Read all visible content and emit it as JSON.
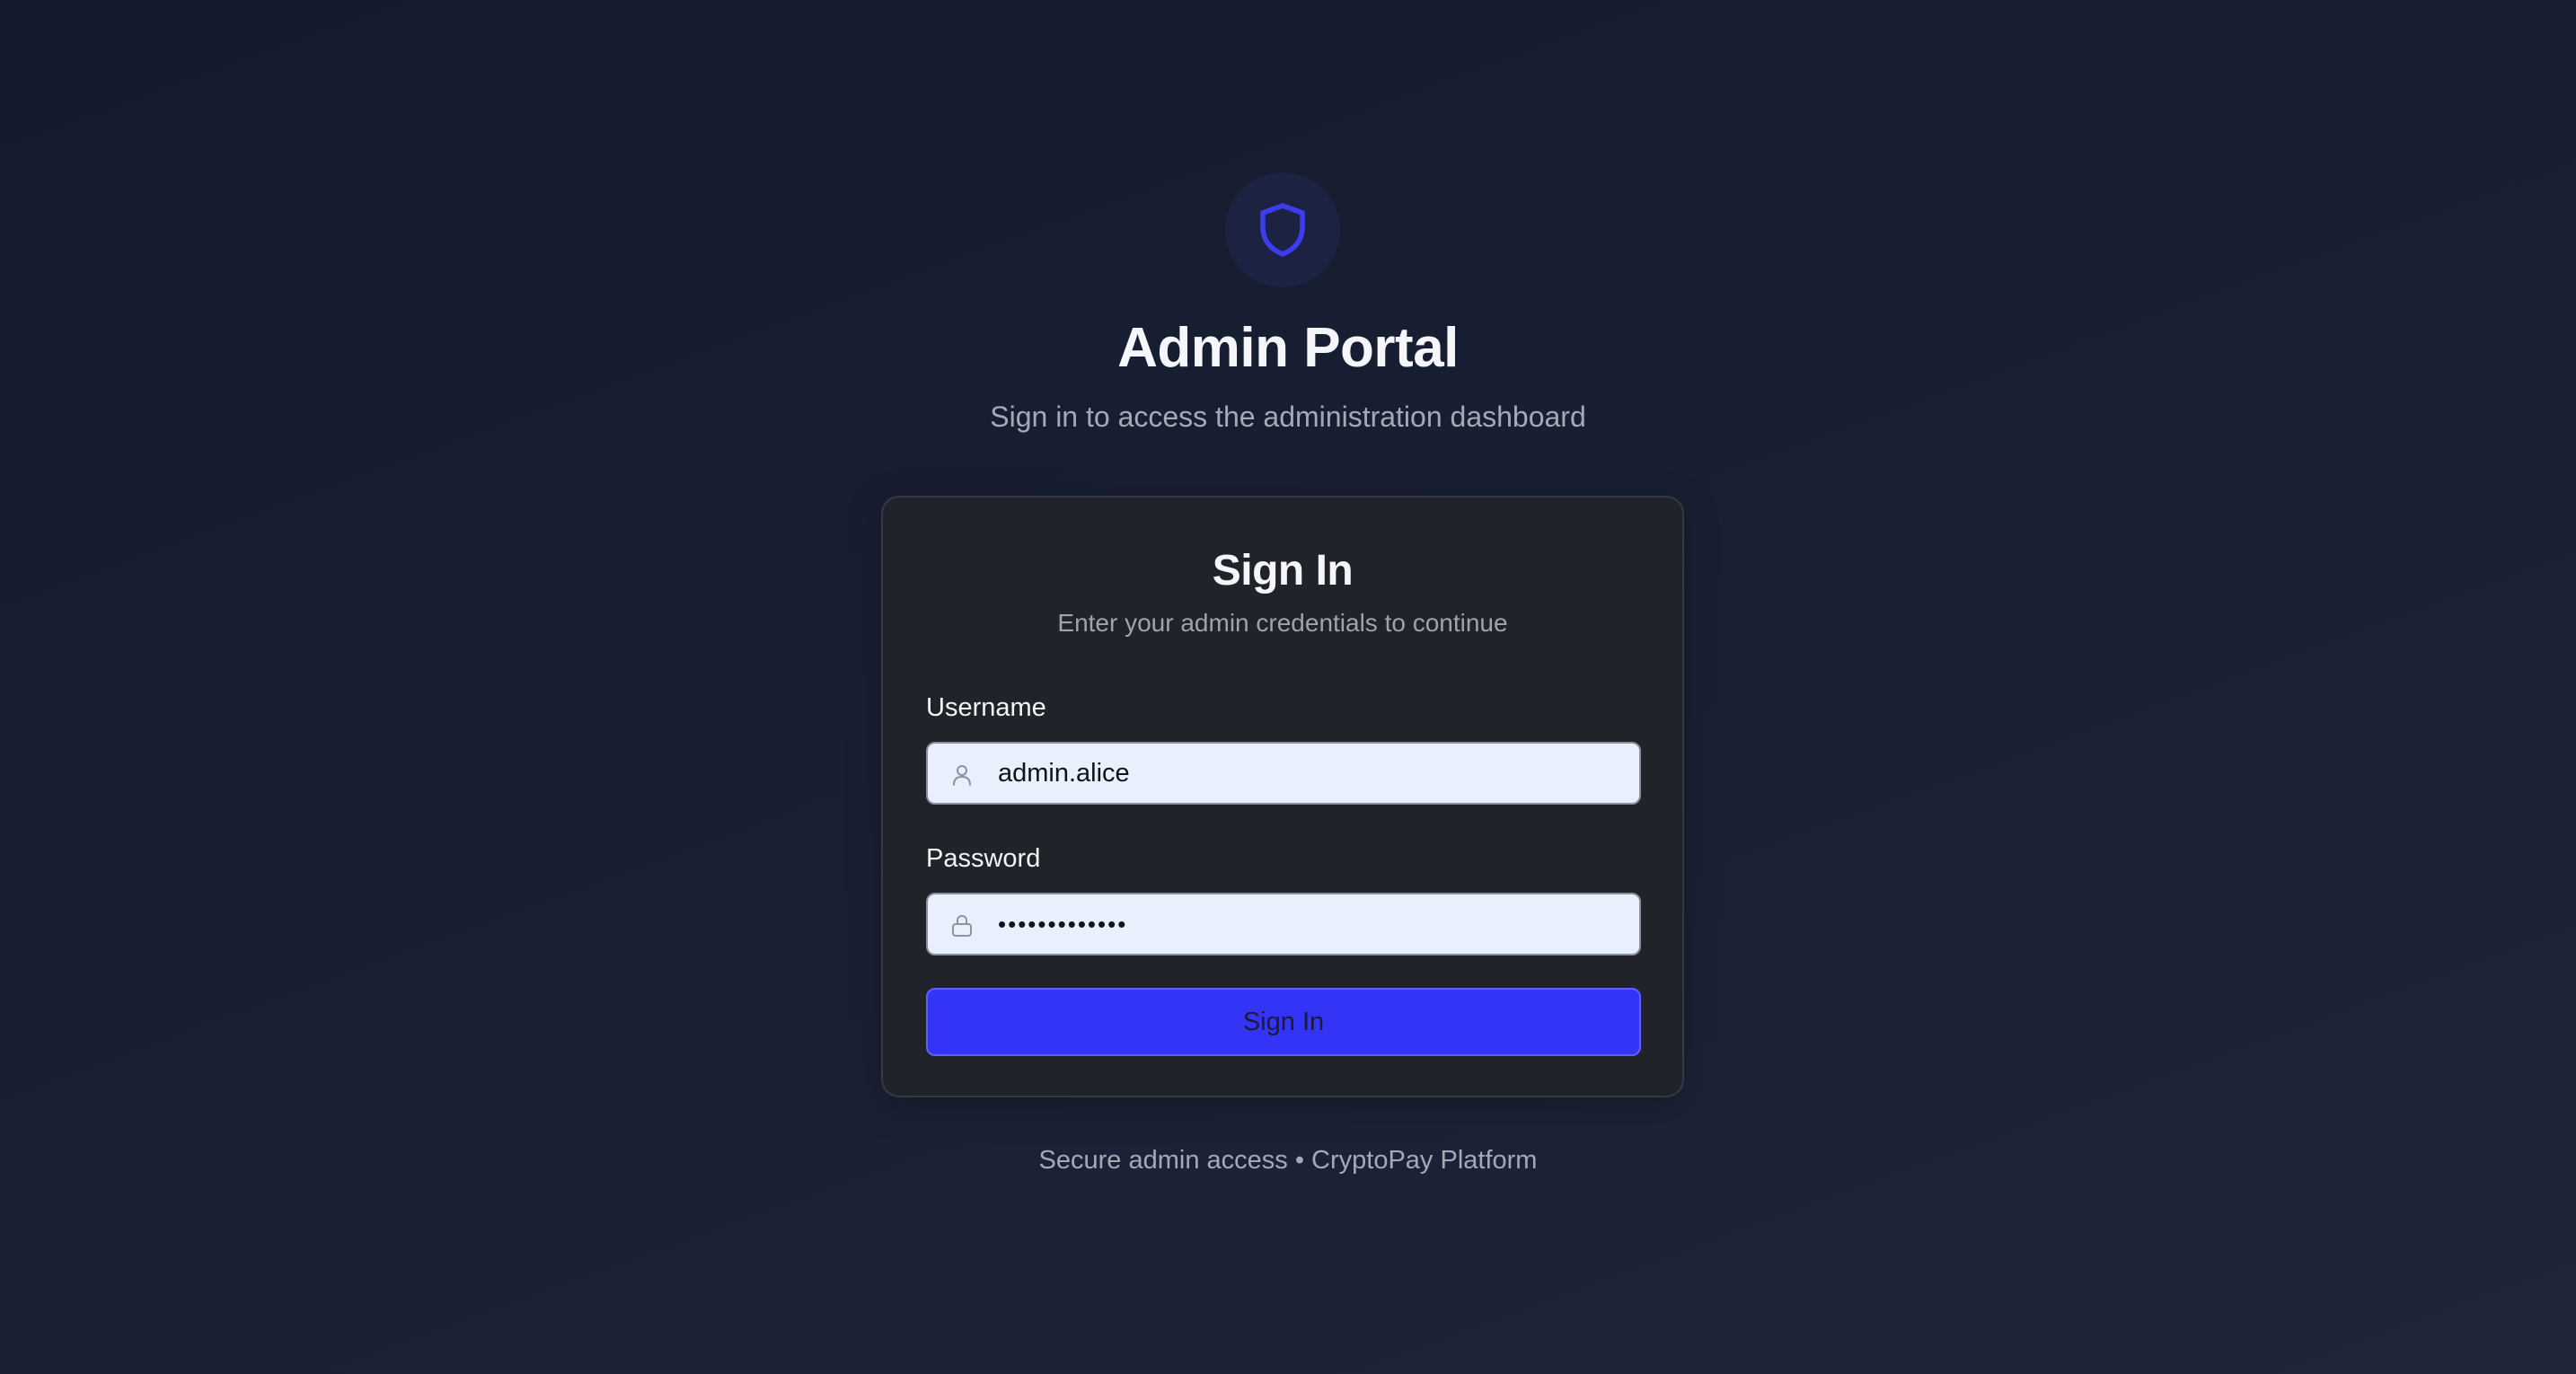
{
  "header": {
    "logo_icon": "shield-icon",
    "title": "Admin Portal",
    "subtitle": "Sign in to access the administration dashboard"
  },
  "card": {
    "title": "Sign In",
    "subtitle": "Enter your admin credentials to continue",
    "username": {
      "label": "Username",
      "icon": "user-icon",
      "value": "admin.alice"
    },
    "password": {
      "label": "Password",
      "icon": "lock-icon",
      "masked_value": "•••••••••••••"
    },
    "submit_label": "Sign In"
  },
  "footer": {
    "text": "Secure admin access • CryptoPay Platform"
  },
  "colors": {
    "background": "#171c2f",
    "card": "#202329",
    "accent": "#3434f7",
    "input_bg": "#e8effd",
    "shield": "#3c3cf0"
  }
}
